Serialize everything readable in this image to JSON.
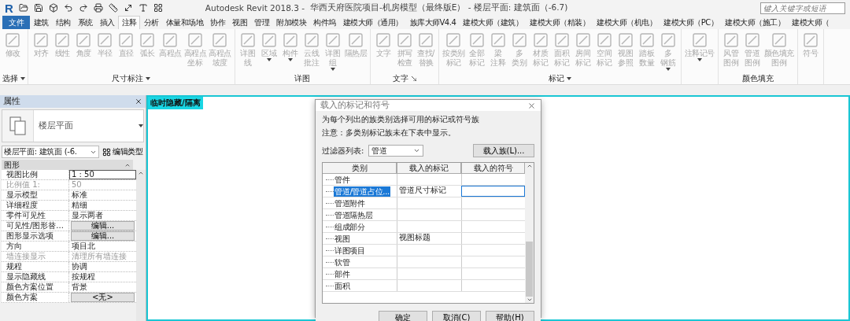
{
  "title_bar": {
    "app_logo": "R",
    "app_name": "Autodesk Revit 2018.3 -",
    "document": "华西天府医院项目-机房模型（最终版E） - 楼层平面: 建筑面（-6.7)",
    "search": {
      "placeholder": "键入关键字或短语"
    }
  },
  "tabs": [
    {
      "label": "文件",
      "kind": "file",
      "selected": false
    },
    {
      "label": "建筑",
      "kind": "tab",
      "selected": false
    },
    {
      "label": "结构",
      "kind": "tab",
      "selected": false
    },
    {
      "label": "系统",
      "kind": "tab",
      "selected": false
    },
    {
      "label": "插入",
      "kind": "tab",
      "selected": false
    },
    {
      "label": "注释",
      "kind": "tab",
      "selected": true
    },
    {
      "label": "分析",
      "kind": "tab",
      "selected": false
    },
    {
      "label": "体量和场地",
      "kind": "tab",
      "selected": false
    },
    {
      "label": "协作",
      "kind": "tab",
      "selected": false
    },
    {
      "label": "视图",
      "kind": "tab",
      "selected": false
    },
    {
      "label": "管理",
      "kind": "tab",
      "selected": false
    },
    {
      "label": "附加模块",
      "kind": "tab",
      "selected": false
    },
    {
      "label": "构件坞",
      "kind": "tab",
      "selected": false
    },
    {
      "label": "建模大师（通用）",
      "kind": "tab",
      "selected": false
    },
    {
      "label": "族库大师V4.4",
      "kind": "tab",
      "selected": false
    },
    {
      "label": "建模大师（建筑）",
      "kind": "tab",
      "selected": false
    },
    {
      "label": "建模大师（精装）",
      "kind": "tab",
      "selected": false
    },
    {
      "label": "建模大师（机电）",
      "kind": "tab",
      "selected": false
    },
    {
      "label": "建模大师（PC）",
      "kind": "tab",
      "selected": false
    },
    {
      "label": "建模大师（施工）",
      "kind": "tab",
      "selected": false
    },
    {
      "label": "建模大师（",
      "kind": "tab",
      "selected": false
    }
  ],
  "ribbon": {
    "panels": [
      {
        "title": "选择",
        "dropdown": true,
        "launcher": false,
        "tools": [
          {
            "lines": [
              "修改"
            ],
            "disabled": true
          }
        ]
      },
      {
        "title": "尺寸标注",
        "dropdown": true,
        "launcher": false,
        "tools": [
          {
            "lines": [
              "对齐"
            ],
            "disabled": true
          },
          {
            "lines": [
              "线性"
            ],
            "disabled": true
          },
          {
            "lines": [
              "角度"
            ],
            "disabled": true
          },
          {
            "lines": [
              "半径"
            ],
            "disabled": true
          },
          {
            "lines": [
              "直径"
            ],
            "disabled": true
          },
          {
            "lines": [
              "弧长"
            ],
            "disabled": true
          },
          {
            "lines": [
              "高程点"
            ],
            "disabled": true
          },
          {
            "lines": [
              "高程点",
              "坐标"
            ],
            "disabled": true
          },
          {
            "lines": [
              "高程点",
              "坡度"
            ],
            "disabled": true
          }
        ]
      },
      {
        "title": "详图",
        "dropdown": false,
        "launcher": false,
        "tools": [
          {
            "lines": [
              "详图",
              "线"
            ],
            "disabled": true
          },
          {
            "lines": [
              "区域"
            ],
            "dropdown": true,
            "disabled": true
          },
          {
            "lines": [
              "构件"
            ],
            "dropdown": true,
            "disabled": true
          },
          {
            "lines": [
              "云线",
              "批注"
            ],
            "disabled": true
          },
          {
            "lines": [
              "详图",
              "组"
            ],
            "dropdown": true,
            "disabled": true
          },
          {
            "lines": [
              "隔热层"
            ],
            "disabled": true
          }
        ]
      },
      {
        "title": "文字",
        "dropdown": false,
        "launcher": true,
        "tools": [
          {
            "lines": [
              "文字"
            ],
            "disabled": true
          },
          {
            "lines": [
              "拼写",
              "检查"
            ],
            "disabled": true
          },
          {
            "lines": [
              "查找/",
              "替换"
            ],
            "disabled": true
          }
        ]
      },
      {
        "title": "标记",
        "dropdown": true,
        "launcher": false,
        "tools": [
          {
            "lines": [
              "按类别",
              "标记"
            ],
            "disabled": true
          },
          {
            "lines": [
              "全部",
              "标记"
            ],
            "disabled": true
          },
          {
            "lines": [
              "梁",
              "注释"
            ],
            "disabled": true
          },
          {
            "lines": [
              "多",
              "类别"
            ],
            "disabled": true
          },
          {
            "lines": [
              "材质",
              "标记"
            ],
            "disabled": true
          },
          {
            "lines": [
              "面积",
              "标记"
            ],
            "disabled": true
          },
          {
            "lines": [
              "房间",
              "标记"
            ],
            "disabled": true
          },
          {
            "lines": [
              "空间",
              "标记"
            ],
            "disabled": true
          },
          {
            "lines": [
              "视图",
              "参照"
            ],
            "disabled": true
          },
          {
            "lines": [
              "踏板",
              "数量"
            ],
            "disabled": true
          },
          {
            "lines": [
              "多",
              "钢筋"
            ],
            "dropdown": true,
            "disabled": true
          }
        ]
      },
      {
        "tools": [
          {
            "lines": [
              "注释记号"
            ],
            "dropdown": true,
            "disabled": true
          }
        ]
      },
      {
        "title": "颜色填充",
        "dropdown": false,
        "launcher": false,
        "tools": [
          {
            "lines": [
              "风管",
              "图例"
            ],
            "disabled": true
          },
          {
            "lines": [
              "管道",
              "图例"
            ],
            "disabled": true
          },
          {
            "lines": [
              "颜色填充",
              "图例"
            ],
            "disabled": true
          }
        ]
      },
      {
        "tools": [
          {
            "lines": [
              "符号"
            ],
            "disabled": true
          }
        ]
      }
    ]
  },
  "properties": {
    "title": "属性",
    "type_name": "楼层平面",
    "instance_selector": "楼层平面: 建筑面 (-6.",
    "edit_type": "编辑类型",
    "section": "图形",
    "rows": [
      {
        "name": "视图比例",
        "value": "1 : 50",
        "kind": "input",
        "disabled": false
      },
      {
        "name": "比例值 1:",
        "value": "50",
        "kind": "text",
        "disabled": true
      },
      {
        "name": "显示模型",
        "value": "标准",
        "kind": "text",
        "disabled": false
      },
      {
        "name": "详细程度",
        "value": "精细",
        "kind": "text",
        "disabled": false
      },
      {
        "name": "零件可见性",
        "value": "显示两者",
        "kind": "text",
        "disabled": false
      },
      {
        "name": "可见性/图形替...",
        "value": "编辑...",
        "kind": "button",
        "disabled": false
      },
      {
        "name": "图形显示选项",
        "value": "编辑...",
        "kind": "button",
        "disabled": false
      },
      {
        "name": "方向",
        "value": "项目北",
        "kind": "text",
        "disabled": false
      },
      {
        "name": "墙连接显示",
        "value": "清理所有墙连接",
        "kind": "text",
        "disabled": true
      },
      {
        "name": "规程",
        "value": "协调",
        "kind": "text",
        "disabled": false
      },
      {
        "name": "显示隐藏线",
        "value": "按规程",
        "kind": "text",
        "disabled": false
      },
      {
        "name": "颜色方案位置",
        "value": "背景",
        "kind": "text",
        "disabled": false
      },
      {
        "name": "颜色方案",
        "value": "<无>",
        "kind": "button",
        "disabled": false
      }
    ]
  },
  "canvas": {
    "isolate_label": "临时隐藏/隔离"
  },
  "dialog": {
    "title": "载入的标记和符号",
    "intro": "为每个列出的族类别选择可用的标记或符号族",
    "note": "注意：多类别标记族未在下表中显示。",
    "filter_label": "过滤器列表:",
    "filter_value": "管道",
    "load_button": "载入族(L)...",
    "columns": [
      "类别",
      "载入的标记",
      "载入的符号"
    ],
    "rows": [
      {
        "category": "管件",
        "selected": false
      },
      {
        "category": "管道/管道占位...",
        "tag": "管道尺寸标记",
        "selected": true
      },
      {
        "category": "管道附件",
        "selected": false
      },
      {
        "category": "管道隔热层",
        "selected": false
      },
      {
        "category": "组成部分",
        "selected": false
      },
      {
        "category": "视图",
        "tag": "视图标题",
        "selected": false
      },
      {
        "category": "详图项目",
        "selected": false
      },
      {
        "category": "软管",
        "selected": false
      },
      {
        "category": "部件",
        "selected": false
      },
      {
        "category": "面积",
        "selected": false
      }
    ],
    "buttons": [
      "确定",
      "取消(C)",
      "帮助(H)"
    ]
  }
}
